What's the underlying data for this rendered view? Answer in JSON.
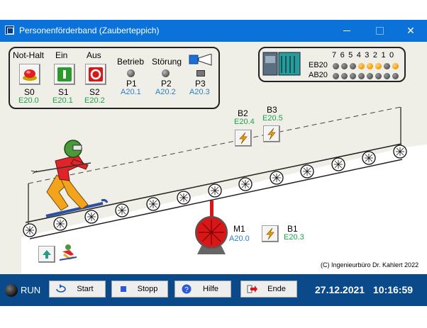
{
  "window": {
    "title": "Personenförderband (Zauberteppich)"
  },
  "panel_left": {
    "buttons": [
      {
        "header": "Not-Halt",
        "name": "S0",
        "code": "E20.0"
      },
      {
        "header": "Ein",
        "name": "S1",
        "code": "E20.1"
      },
      {
        "header": "Aus",
        "name": "S2",
        "code": "E20.2"
      }
    ],
    "lamps": [
      {
        "header": "Betrieb",
        "name": "P1",
        "code": "A20.1"
      },
      {
        "header": "Störung",
        "name": "P2",
        "code": "A20.2"
      },
      {
        "header": "",
        "name": "P3",
        "code": "A20.3"
      }
    ]
  },
  "panel_plc": {
    "bit_labels": "7 6 5 4 3 2 1 0",
    "rows": [
      {
        "label": "EB20",
        "states": [
          "off",
          "off",
          "off",
          "on",
          "on",
          "on",
          "off",
          "on"
        ]
      },
      {
        "label": "AB20",
        "states": [
          "off",
          "off",
          "off",
          "off",
          "off",
          "off",
          "off",
          "off"
        ]
      }
    ]
  },
  "sensors": [
    {
      "name": "B2",
      "code": "E20.4"
    },
    {
      "name": "B3",
      "code": "E20.5"
    },
    {
      "name": "B1",
      "code": "E20.3"
    }
  ],
  "motor": {
    "name": "M1",
    "code": "A20.0"
  },
  "copyright": "(C) Ingenieurbüro Dr. Kahlert 2022",
  "statusbar": {
    "run_label": "RUN",
    "start_label": "Start",
    "stop_label": "Stopp",
    "help_label": "Hilfe",
    "end_label": "Ende",
    "date": "27.12.2021",
    "time": "10:16:59"
  },
  "colors": {
    "title": "#0a72d8",
    "status": "#0a4a8a",
    "input_code": "#1aa34a",
    "output_code": "#2b7fc7",
    "led_on": "#f29a00"
  }
}
